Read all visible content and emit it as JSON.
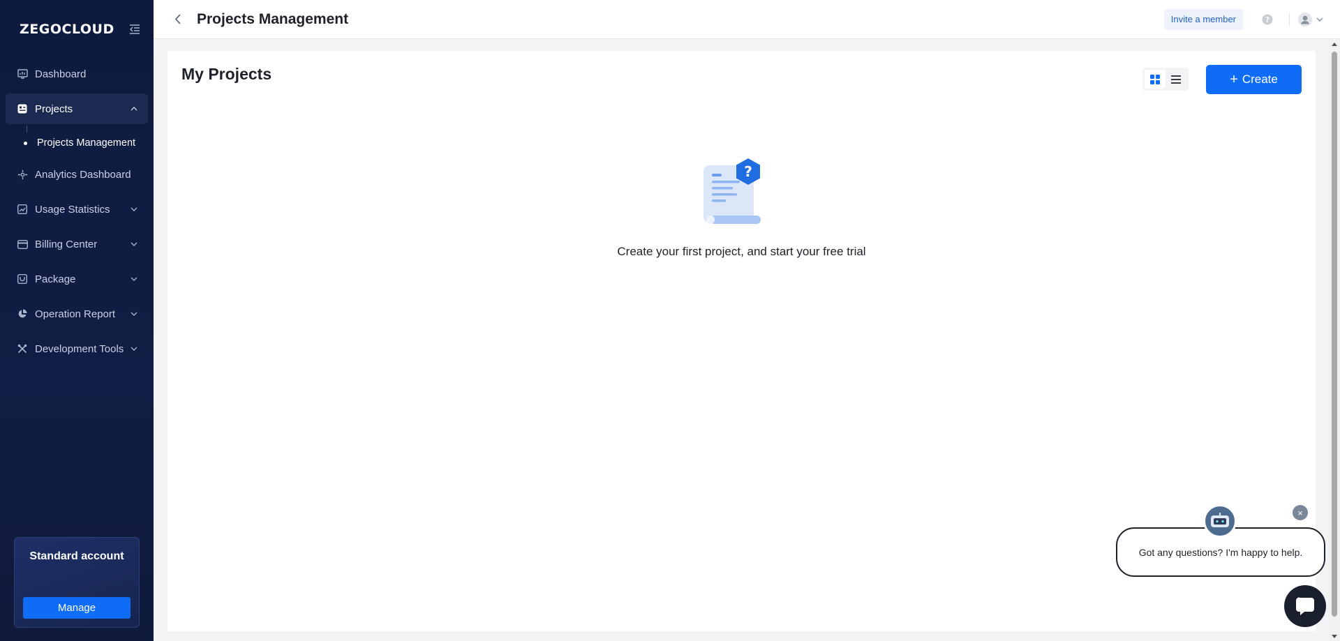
{
  "app": {
    "logo": "ZEGOCLOUD"
  },
  "sidebar": {
    "items": [
      {
        "label": "Dashboard",
        "icon": "dashboard-icon"
      },
      {
        "label": "Projects",
        "icon": "projects-icon",
        "expanded": true
      },
      {
        "label": "Analytics Dashboard",
        "icon": "analytics-icon"
      },
      {
        "label": "Usage Statistics",
        "icon": "usage-icon"
      },
      {
        "label": "Billing Center",
        "icon": "billing-icon"
      },
      {
        "label": "Package",
        "icon": "package-icon"
      },
      {
        "label": "Operation Report",
        "icon": "report-icon"
      },
      {
        "label": "Development Tools",
        "icon": "tools-icon"
      }
    ],
    "sub_items": [
      {
        "label": "Projects Management",
        "active": true
      }
    ],
    "account": {
      "title": "Standard account",
      "manage_label": "Manage"
    }
  },
  "header": {
    "title": "Projects Management",
    "invite_label": "Invite a member"
  },
  "main": {
    "title": "My Projects",
    "create_label": "Create",
    "view_mode": "grid",
    "empty_text": "Create your first project, and start your free trial"
  },
  "chat": {
    "message": "Got any questions? I'm happy to help.",
    "close_label": "×"
  },
  "colors": {
    "primary": "#0f6cf7",
    "sidebar_bg": "#0f1b3d",
    "sidebar_active": "#1c2a52"
  }
}
